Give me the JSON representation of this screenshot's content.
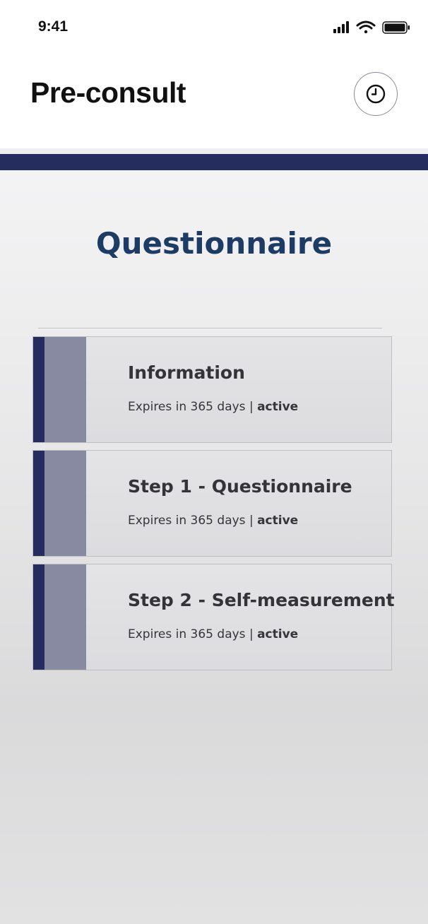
{
  "status_bar": {
    "time": "9:41",
    "signal_icon": "cellular-signal-icon",
    "wifi_icon": "wifi-icon",
    "battery_icon": "battery-icon"
  },
  "header": {
    "title": "Pre-consult",
    "history_icon": "clock-icon"
  },
  "main": {
    "section_title": "Questionnaire",
    "cards": [
      {
        "title": "Information",
        "expiry": "Expires in 365 days",
        "separator": "|",
        "status": "active"
      },
      {
        "title": "Step 1 - Questionnaire",
        "expiry": "Expires in 365 days",
        "separator": "|",
        "status": "active"
      },
      {
        "title": "Step 2 - Self-measurement",
        "expiry": "Expires in 365 days",
        "separator": "|",
        "status": "active"
      }
    ]
  },
  "colors": {
    "brand_navy": "#252c5e",
    "title_blue": "#1c3c66",
    "card_band": "#878aa0"
  }
}
